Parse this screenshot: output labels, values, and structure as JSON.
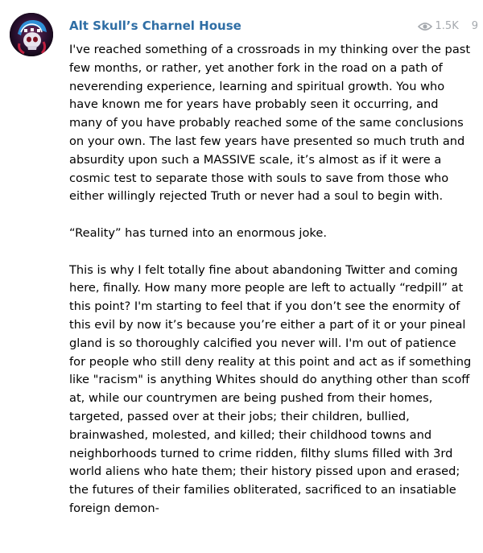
{
  "message": {
    "channel_name": "Alt Skull’s Charnel House",
    "views": "1.5K",
    "time_fragment": "9",
    "avatar_icon": "skull-avatar-icon",
    "views_icon": "eye-icon",
    "paragraphs": [
      "I've reached something of a crossroads in my thinking over the past few months, or rather, yet another fork in the road on a path of neverending experience, learning and spiritual growth. You who have known me for years have probably seen it occurring, and many of you have probably reached some of the same conclusions on your own. The last few years have presented so much truth and absurdity upon such a MASSIVE scale, it’s almost as if it were a cosmic test to separate those with souls to save from those who either willingly rejected Truth or never had a soul to begin with.",
      "“Reality” has turned into an enormous joke.",
      "This is why I felt totally fine about abandoning Twitter and coming here, finally. How many more people are left to actually “redpill” at this point? I'm starting to feel that if you don’t see the enormity of this evil by now it’s because you’re either a part of it or your pineal gland is so thoroughly calcified you never will. I'm out of patience for people who still deny reality at this point and act as if something like \"racism\" is anything Whites should do anything other than scoff at, while our countrymen are being pushed from their homes, targeted, passed over at their jobs; their children, bullied, brainwashed, molested, and killed; their childhood towns and neighborhoods turned to crime ridden, filthy slums filled with 3rd world aliens who hate them; their history pissed upon and erased; the futures of their families obliterated, sacrificed to an insatiable foreign demon-"
    ]
  },
  "colors": {
    "channel_name": "#2f6ea5",
    "meta": "#a5a9ae",
    "text": "#000000"
  }
}
